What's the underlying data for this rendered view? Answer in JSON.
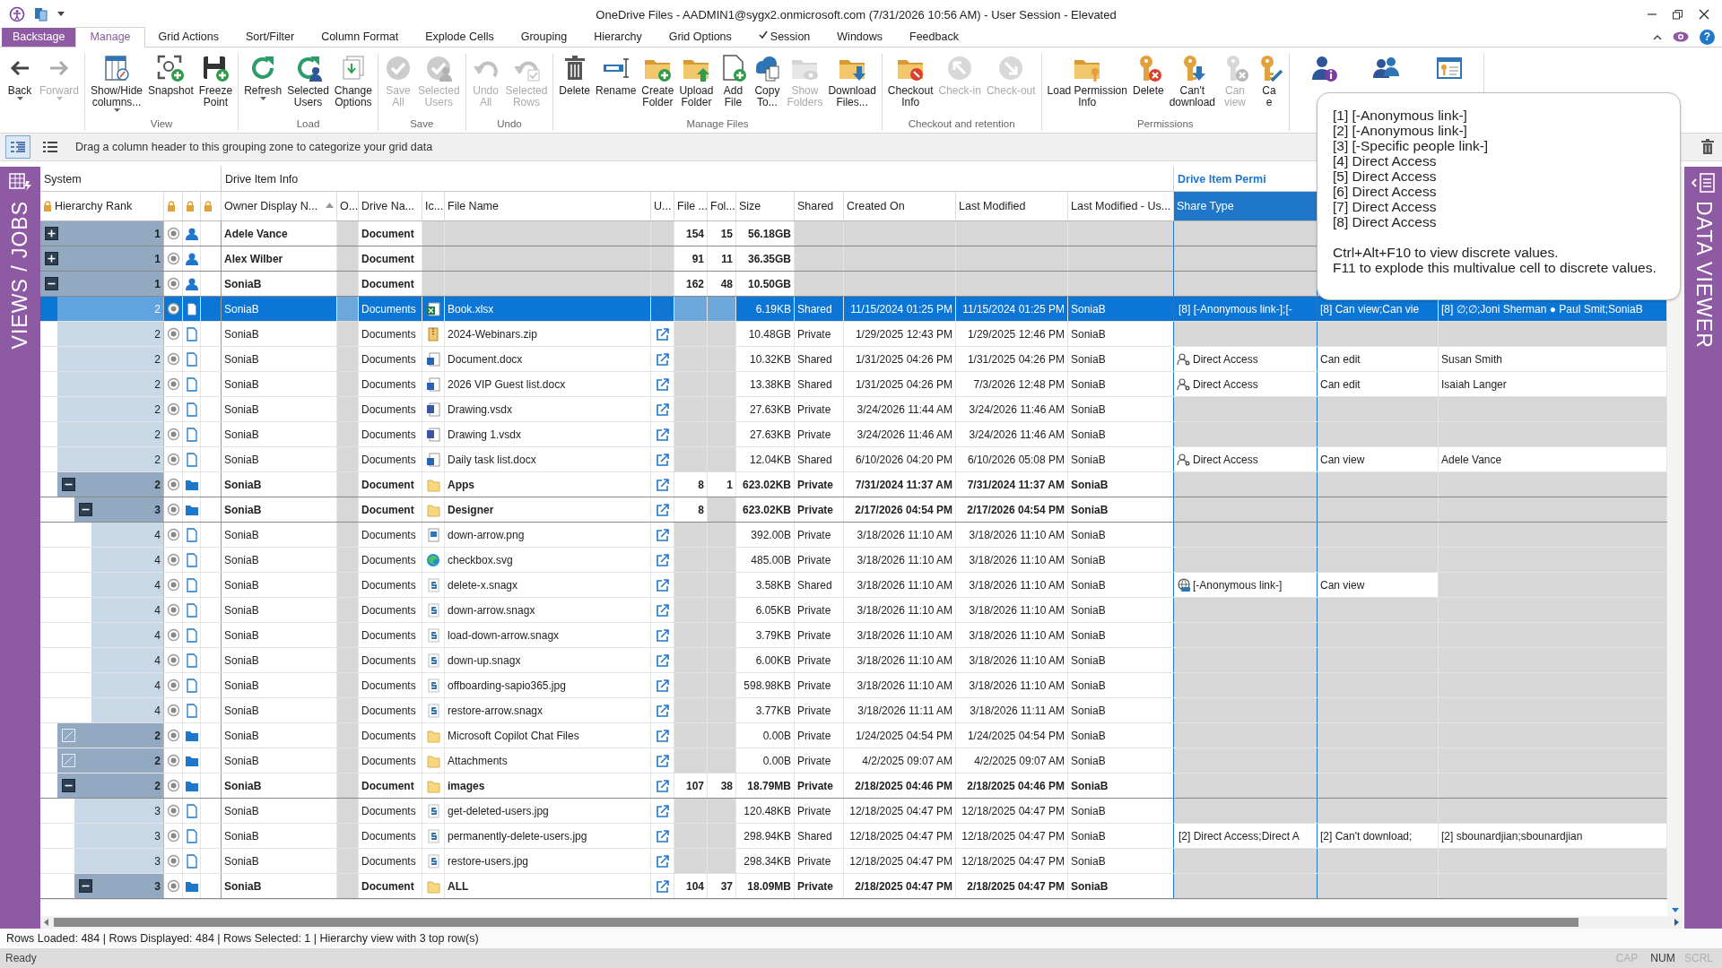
{
  "title_bar": {
    "title": "OneDrive Files - AADMIN1@sygx2.onmicrosoft.com (7/31/2026 10:56 AM) - User Session - Elevated"
  },
  "tabs": [
    {
      "label": "Backstage",
      "kind": "backstage",
      "selected": false,
      "checked": false
    },
    {
      "label": "Manage",
      "kind": "tab",
      "selected": true,
      "checked": false
    },
    {
      "label": "Grid Actions",
      "kind": "tab",
      "selected": false,
      "checked": false
    },
    {
      "label": "Sort/Filter",
      "kind": "tab",
      "selected": false,
      "checked": false
    },
    {
      "label": "Column Format",
      "kind": "tab",
      "selected": false,
      "checked": false
    },
    {
      "label": "Explode Cells",
      "kind": "tab",
      "selected": false,
      "checked": false
    },
    {
      "label": "Grouping",
      "kind": "tab",
      "selected": false,
      "checked": false
    },
    {
      "label": "Hierarchy",
      "kind": "tab",
      "selected": false,
      "checked": false
    },
    {
      "label": "Grid Options",
      "kind": "tab",
      "selected": false,
      "checked": false
    },
    {
      "label": "Session",
      "kind": "tab",
      "selected": false,
      "checked": true
    },
    {
      "label": "Windows",
      "kind": "tab",
      "selected": false,
      "checked": false
    },
    {
      "label": "Feedback",
      "kind": "tab",
      "selected": false,
      "checked": false
    }
  ],
  "help": {
    "glyph": "?"
  },
  "ribbon": {
    "groups": [
      {
        "buttons": [
          {
            "lines": [
              "Back"
            ],
            "disabled": false,
            "dropdown": true
          },
          {
            "lines": [
              "Forward"
            ],
            "disabled": true,
            "dropdown": true
          }
        ]
      },
      {
        "label": "View",
        "buttons": [
          {
            "lines": [
              "Show/Hide",
              "columns..."
            ],
            "disabled": false,
            "dropdown": true
          },
          {
            "lines": [
              "Snapshot"
            ],
            "disabled": false,
            "dropdown": false
          },
          {
            "lines": [
              "Freeze",
              "Point"
            ],
            "disabled": false,
            "dropdown": false
          }
        ]
      },
      {
        "label": "Load",
        "buttons": [
          {
            "lines": [
              "Refresh"
            ],
            "disabled": false,
            "dropdown": true
          },
          {
            "lines": [
              "Selected",
              "Users"
            ],
            "disabled": false,
            "dropdown": false
          },
          {
            "lines": [
              "Change",
              "Options"
            ],
            "disabled": false,
            "dropdown": false
          }
        ]
      },
      {
        "label": "Save",
        "buttons": [
          {
            "lines": [
              "Save",
              "All"
            ],
            "disabled": true,
            "dropdown": false
          },
          {
            "lines": [
              "Selected",
              "Users"
            ],
            "disabled": true,
            "dropdown": false
          }
        ]
      },
      {
        "label": "Undo",
        "buttons": [
          {
            "lines": [
              "Undo",
              "All"
            ],
            "disabled": true,
            "dropdown": false
          },
          {
            "lines": [
              "Selected",
              "Rows"
            ],
            "disabled": true,
            "dropdown": false
          }
        ]
      },
      {
        "label": "Manage Files",
        "buttons": [
          {
            "lines": [
              "Delete"
            ],
            "disabled": false,
            "dropdown": false
          },
          {
            "lines": [
              "Rename"
            ],
            "disabled": false,
            "dropdown": false
          },
          {
            "lines": [
              "Create",
              "Folder"
            ],
            "disabled": false,
            "dropdown": false
          },
          {
            "lines": [
              "Upload",
              "Folder"
            ],
            "disabled": false,
            "dropdown": false
          },
          {
            "lines": [
              "Add",
              "File"
            ],
            "disabled": false,
            "dropdown": false
          },
          {
            "lines": [
              "Copy",
              "To..."
            ],
            "disabled": false,
            "dropdown": false
          },
          {
            "lines": [
              "Show",
              "Folders"
            ],
            "disabled": true,
            "dropdown": false
          },
          {
            "lines": [
              "Download",
              "Files..."
            ],
            "disabled": false,
            "dropdown": false
          }
        ]
      },
      {
        "label": "Checkout and retention",
        "buttons": [
          {
            "lines": [
              "Checkout",
              "Info"
            ],
            "disabled": false,
            "dropdown": false
          },
          {
            "lines": [
              "Check-in"
            ],
            "disabled": true,
            "dropdown": false
          },
          {
            "lines": [
              "Check-out"
            ],
            "disabled": true,
            "dropdown": false
          }
        ]
      },
      {
        "label": "Permissions",
        "buttons": [
          {
            "lines": [
              "Load Permission",
              "Info"
            ],
            "disabled": false,
            "dropdown": false
          },
          {
            "lines": [
              "Delete"
            ],
            "disabled": false,
            "dropdown": false
          },
          {
            "lines": [
              "Can't",
              "download"
            ],
            "disabled": false,
            "dropdown": false
          },
          {
            "lines": [
              "Can",
              "view"
            ],
            "disabled": true,
            "dropdown": false
          },
          {
            "lines": [
              "Ca",
              "e"
            ],
            "disabled": false,
            "dropdown": false
          }
        ]
      },
      {
        "buttons": [
          {
            "disabled": false,
            "dropdown": false
          },
          {
            "disabled": false,
            "dropdown": false
          },
          {
            "disabled": false,
            "dropdown": false
          }
        ]
      }
    ]
  },
  "group_zone": {
    "views": [
      {
        "selected": true
      },
      {
        "selected": false
      }
    ],
    "hint": "Drag a column header to this grouping zone to categorize your grid data"
  },
  "left_panel": {
    "label": "VIEWS / JOBS"
  },
  "right_panel": {
    "label": "DATA VIEWER"
  },
  "grid": {
    "bands": [
      {
        "label": "System",
        "selected": false
      },
      {
        "label": "Drive Item Info",
        "selected": false
      },
      {
        "label": "Drive Item Permi",
        "selected": true
      }
    ],
    "columns": [
      {
        "label": "Hierarchy Rank",
        "locked": true,
        "sorted": false,
        "selected": false
      },
      {
        "locked": true,
        "sorted": false,
        "selected": false
      },
      {
        "locked": true,
        "sorted": false,
        "selected": false
      },
      {
        "locked": true,
        "sorted": false,
        "selected": false
      },
      {
        "label": "Owner Display N...",
        "locked": false,
        "sorted": true,
        "selected": false
      },
      {
        "label": "O...",
        "locked": false,
        "sorted": false,
        "selected": false
      },
      {
        "label": "Drive Na...",
        "locked": false,
        "sorted": false,
        "selected": false
      },
      {
        "label": "Ic...",
        "locked": false,
        "sorted": false,
        "selected": false
      },
      {
        "label": "File Name",
        "locked": false,
        "sorted": false,
        "selected": false
      },
      {
        "label": "U...",
        "locked": false,
        "sorted": false,
        "selected": false
      },
      {
        "label": "File ...",
        "locked": false,
        "sorted": false,
        "selected": false
      },
      {
        "label": "Fol...",
        "locked": false,
        "sorted": false,
        "selected": false
      },
      {
        "label": "Size",
        "locked": false,
        "sorted": false,
        "selected": false
      },
      {
        "label": "Shared",
        "locked": false,
        "sorted": false,
        "selected": false
      },
      {
        "label": "Created On",
        "locked": false,
        "sorted": false,
        "selected": false
      },
      {
        "label": "Last Modified",
        "locked": false,
        "sorted": false,
        "selected": false
      },
      {
        "label": "Last Modified - Us...",
        "locked": false,
        "sorted": false,
        "selected": false
      },
      {
        "label": "Share Type",
        "locked": false,
        "sorted": false,
        "selected": true
      }
    ],
    "rows": [
      {
        "rank": "1",
        "expanded": false,
        "kind": "person",
        "owner": "Adele Vance",
        "drive": "Document",
        "files": "154",
        "folders": "15",
        "size": "56.18GB",
        "selected": false
      },
      {
        "rank": "1",
        "expanded": false,
        "kind": "person",
        "owner": "Alex Wilber",
        "drive": "Document",
        "files": "91",
        "folders": "11",
        "size": "36.35GB",
        "selected": false
      },
      {
        "rank": "1",
        "expanded": true,
        "kind": "person",
        "owner": "SoniaB",
        "drive": "Document",
        "files": "162",
        "folders": "48",
        "size": "10.50GB",
        "selected": false,
        "children": [
          {
            "rank": "2",
            "kind": "xlsx",
            "owner": "SoniaB",
            "drive": "Documents",
            "name": "Book.xlsx",
            "size": "6.19KB",
            "shared": "Shared",
            "created": "11/15/2024 01:25 PM",
            "modified": "11/15/2024 01:25 PM",
            "modified_by": "SoniaB",
            "share": {
              "text": "[8] [-Anonymous link-];[-"
            },
            "roles": "[8] Can view;Can vie",
            "users": "[8] ∅;∅;Joni Sherman ● Paul Smit;SoniaB",
            "selected": true
          },
          {
            "rank": "2",
            "kind": "zip",
            "owner": "SoniaB",
            "drive": "Documents",
            "name": "2024-Webinars.zip",
            "size": "10.48GB",
            "shared": "Private",
            "created": "1/29/2025 12:43 PM",
            "modified": "1/29/2025 12:46 PM",
            "modified_by": "SoniaB",
            "selected": false
          },
          {
            "rank": "2",
            "kind": "docx",
            "owner": "SoniaB",
            "drive": "Documents",
            "name": "Document.docx",
            "size": "10.32KB",
            "shared": "Shared",
            "created": "1/31/2025 04:26 PM",
            "modified": "1/31/2025 04:26 PM",
            "modified_by": "SoniaB",
            "share": {
              "kind": "direct",
              "text": "Direct Access"
            },
            "roles": "Can edit",
            "users": "Susan Smith",
            "selected": false
          },
          {
            "rank": "2",
            "kind": "docx",
            "owner": "SoniaB",
            "drive": "Documents",
            "name": "2026 VIP Guest list.docx",
            "size": "13.38KB",
            "shared": "Shared",
            "created": "1/31/2025 04:26 PM",
            "modified": "7/3/2026 12:48 PM",
            "modified_by": "SoniaB",
            "share": {
              "kind": "direct",
              "text": "Direct Access"
            },
            "roles": "Can edit",
            "users": "Isaiah Langer",
            "selected": false
          },
          {
            "rank": "2",
            "kind": "vsdx",
            "owner": "SoniaB",
            "drive": "Documents",
            "name": "Drawing.vsdx",
            "size": "27.63KB",
            "shared": "Private",
            "created": "3/24/2026 11:44 AM",
            "modified": "3/24/2026 11:46 AM",
            "modified_by": "SoniaB",
            "selected": false
          },
          {
            "rank": "2",
            "kind": "vsdx",
            "owner": "SoniaB",
            "drive": "Documents",
            "name": "Drawing 1.vsdx",
            "size": "27.63KB",
            "shared": "Private",
            "created": "3/24/2026 11:46 AM",
            "modified": "3/24/2026 11:46 AM",
            "modified_by": "SoniaB",
            "selected": false
          },
          {
            "rank": "2",
            "kind": "docx",
            "owner": "SoniaB",
            "drive": "Documents",
            "name": "Daily task list.docx",
            "size": "12.04KB",
            "shared": "Shared",
            "created": "6/10/2026 04:20 PM",
            "modified": "6/10/2026 05:08 PM",
            "modified_by": "SoniaB",
            "share": {
              "kind": "direct",
              "text": "Direct Access"
            },
            "roles": "Can view",
            "users": "Adele Vance",
            "selected": false
          },
          {
            "rank": "2",
            "expanded": true,
            "kind": "folder",
            "owner": "SoniaB",
            "drive": "Document",
            "name": "Apps",
            "files": "8",
            "folders": "1",
            "size": "623.02KB",
            "shared": "Private",
            "created": "7/31/2024 11:37 AM",
            "modified": "7/31/2024 11:37 AM",
            "modified_by": "SoniaB",
            "selected": false,
            "children": [
              {
                "rank": "3",
                "expanded": true,
                "kind": "folder",
                "owner": "SoniaB",
                "drive": "Document",
                "name": "Designer",
                "files": "8",
                "size": "623.02KB",
                "shared": "Private",
                "created": "2/17/2026 04:54 PM",
                "modified": "2/17/2026 04:54 PM",
                "modified_by": "SoniaB",
                "selected": false,
                "children": [
                  {
                    "rank": "4",
                    "kind": "png",
                    "owner": "SoniaB",
                    "drive": "Documents",
                    "name": "down-arrow.png",
                    "size": "392.00B",
                    "shared": "Private",
                    "created": "3/18/2026 11:10 AM",
                    "modified": "3/18/2026 11:10 AM",
                    "modified_by": "SoniaB",
                    "selected": false
                  },
                  {
                    "rank": "4",
                    "kind": "svg",
                    "owner": "SoniaB",
                    "drive": "Documents",
                    "name": "checkbox.svg",
                    "size": "485.00B",
                    "shared": "Private",
                    "created": "3/18/2026 11:10 AM",
                    "modified": "3/18/2026 11:10 AM",
                    "modified_by": "SoniaB",
                    "selected": false
                  },
                  {
                    "rank": "4",
                    "kind": "snagx",
                    "owner": "SoniaB",
                    "drive": "Documents",
                    "name": "delete-x.snagx",
                    "size": "3.58KB",
                    "shared": "Shared",
                    "created": "3/18/2026 11:10 AM",
                    "modified": "3/18/2026 11:10 AM",
                    "modified_by": "SoniaB",
                    "share": {
                      "kind": "anonymous",
                      "text": "[-Anonymous link-]"
                    },
                    "roles": "Can view",
                    "selected": false
                  },
                  {
                    "rank": "4",
                    "kind": "snagx",
                    "owner": "SoniaB",
                    "drive": "Documents",
                    "name": "down-arrow.snagx",
                    "size": "6.05KB",
                    "shared": "Private",
                    "created": "3/18/2026 11:10 AM",
                    "modified": "3/18/2026 11:10 AM",
                    "modified_by": "SoniaB",
                    "selected": false
                  },
                  {
                    "rank": "4",
                    "kind": "snagx",
                    "owner": "SoniaB",
                    "drive": "Documents",
                    "name": "load-down-arrow.snagx",
                    "size": "3.79KB",
                    "shared": "Private",
                    "created": "3/18/2026 11:10 AM",
                    "modified": "3/18/2026 11:10 AM",
                    "modified_by": "SoniaB",
                    "selected": false
                  },
                  {
                    "rank": "4",
                    "kind": "snagx",
                    "owner": "SoniaB",
                    "drive": "Documents",
                    "name": "down-up.snagx",
                    "size": "6.00KB",
                    "shared": "Private",
                    "created": "3/18/2026 11:10 AM",
                    "modified": "3/18/2026 11:10 AM",
                    "modified_by": "SoniaB",
                    "selected": false
                  },
                  {
                    "rank": "4",
                    "kind": "snagx",
                    "owner": "SoniaB",
                    "drive": "Documents",
                    "name": "offboarding-sapio365.jpg",
                    "size": "598.98KB",
                    "shared": "Private",
                    "created": "3/18/2026 11:10 AM",
                    "modified": "3/18/2026 11:10 AM",
                    "modified_by": "SoniaB",
                    "selected": false
                  },
                  {
                    "rank": "4",
                    "kind": "snagx",
                    "owner": "SoniaB",
                    "drive": "Documents",
                    "name": "restore-arrow.snagx",
                    "size": "3.77KB",
                    "shared": "Private",
                    "created": "3/18/2026 11:11 AM",
                    "modified": "3/18/2026 11:11 AM",
                    "modified_by": "SoniaB",
                    "selected": false
                  }
                ]
              }
            ]
          },
          {
            "rank": "2",
            "empty": true,
            "kind": "folder",
            "owner": "SoniaB",
            "drive": "Documents",
            "name": "Microsoft Copilot Chat Files",
            "size": "0.00B",
            "shared": "Private",
            "created": "1/24/2025 04:54 PM",
            "modified": "1/24/2025 04:54 PM",
            "modified_by": "SoniaB",
            "selected": false
          },
          {
            "rank": "2",
            "empty": true,
            "kind": "folder",
            "owner": "SoniaB",
            "drive": "Documents",
            "name": "Attachments",
            "size": "0.00B",
            "shared": "Private",
            "created": "4/2/2025 09:07 AM",
            "modified": "4/2/2025 09:07 AM",
            "modified_by": "SoniaB",
            "selected": false
          },
          {
            "rank": "2",
            "expanded": true,
            "kind": "folder",
            "owner": "SoniaB",
            "drive": "Document",
            "name": "images",
            "files": "107",
            "folders": "38",
            "size": "18.79MB",
            "shared": "Private",
            "created": "2/18/2025 04:46 PM",
            "modified": "2/18/2025 04:46 PM",
            "modified_by": "SoniaB",
            "selected": false,
            "children": [
              {
                "rank": "3",
                "kind": "snagx",
                "owner": "SoniaB",
                "drive": "Documents",
                "name": "get-deleted-users.jpg",
                "size": "120.48KB",
                "shared": "Private",
                "created": "12/18/2025 04:47 PM",
                "modified": "12/18/2025 04:47 PM",
                "modified_by": "SoniaB",
                "selected": false
              },
              {
                "rank": "3",
                "kind": "snagx",
                "owner": "SoniaB",
                "drive": "Documents",
                "name": "permanently-delete-users.jpg",
                "size": "298.94KB",
                "shared": "Shared",
                "created": "12/18/2025 04:47 PM",
                "modified": "12/18/2025 04:47 PM",
                "modified_by": "SoniaB",
                "share": {
                  "text": "[2] Direct Access;Direct A"
                },
                "roles": "[2] Can't download;",
                "users": "[2] sbounardjian;sbounardjian",
                "selected": false
              },
              {
                "rank": "3",
                "kind": "snagx",
                "owner": "SoniaB",
                "drive": "Documents",
                "name": "restore-users.jpg",
                "size": "298.34KB",
                "shared": "Private",
                "created": "12/18/2025 04:47 PM",
                "modified": "12/18/2025 04:47 PM",
                "modified_by": "SoniaB",
                "selected": false
              },
              {
                "rank": "3",
                "expanded": true,
                "kind": "folder",
                "owner": "SoniaB",
                "drive": "Document",
                "name": "ALL",
                "files": "104",
                "folders": "37",
                "size": "18.09MB",
                "shared": "Private",
                "created": "2/18/2025 04:47 PM",
                "modified": "2/18/2025 04:47 PM",
                "modified_by": "SoniaB",
                "selected": false
              }
            ]
          }
        ]
      }
    ]
  },
  "tooltip": {
    "lines": [
      "[1] [-Anonymous link-]",
      "[2] [-Anonymous link-]",
      "[3] [-Specific people link-]",
      "[4] Direct Access",
      "[5] Direct Access",
      "[6] Direct Access",
      "[7] Direct Access",
      "[8] Direct Access"
    ],
    "hints": [
      "Ctrl+Alt+F10 to view discrete values.",
      "F11 to explode this multivalue cell to discrete values."
    ]
  },
  "status_bar": {
    "text": "Rows Loaded: 484 | Rows Displayed: 484 | Rows Selected: 1 | Hierarchy view with 3 top row(s)",
    "state": "Ready",
    "indicators": [
      {
        "label": "CAP",
        "on": false
      },
      {
        "label": "NUM",
        "on": true
      },
      {
        "label": "SCRL",
        "on": false
      }
    ]
  }
}
